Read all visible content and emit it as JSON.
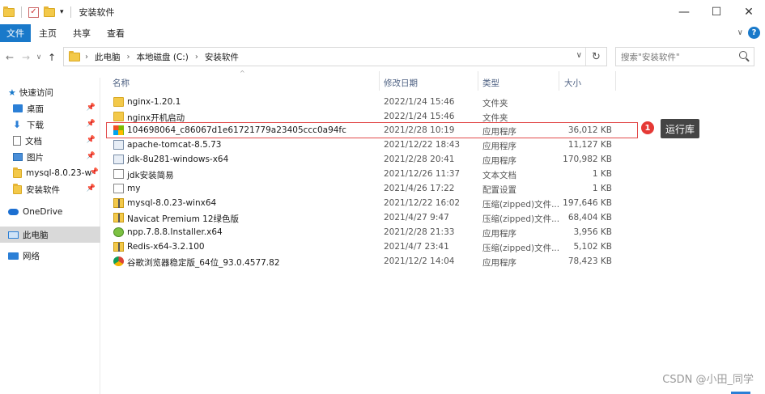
{
  "window": {
    "title": "安装软件",
    "controls": [
      "—",
      "☐",
      "✕"
    ]
  },
  "ribbon": {
    "tabs": [
      "文件",
      "主页",
      "共享",
      "查看"
    ],
    "active_tab": "文件"
  },
  "address": {
    "breadcrumbs": [
      "此电脑",
      "本地磁盘 (C:)",
      "安装软件"
    ],
    "search_placeholder": "搜索\"安装软件\""
  },
  "sidebar": {
    "items": [
      {
        "label": "快速访问",
        "icon": "star-icon"
      },
      {
        "label": "桌面",
        "icon": "desktop-icon",
        "pinned": true
      },
      {
        "label": "下载",
        "icon": "download-icon",
        "pinned": true
      },
      {
        "label": "文档",
        "icon": "document-icon",
        "pinned": true
      },
      {
        "label": "图片",
        "icon": "picture-icon",
        "pinned": true
      },
      {
        "label": "mysql-8.0.23-w",
        "icon": "folder-icon",
        "pinned": true
      },
      {
        "label": "安装软件",
        "icon": "folder-icon",
        "pinned": true
      },
      {
        "label": "OneDrive",
        "icon": "cloud-icon"
      },
      {
        "label": "此电脑",
        "icon": "computer-icon",
        "selected": true
      },
      {
        "label": "网络",
        "icon": "network-icon"
      }
    ]
  },
  "columns": {
    "name": "名称",
    "date": "修改日期",
    "type": "类型",
    "size": "大小"
  },
  "files": [
    {
      "name": "nginx-1.20.1",
      "date": "2022/1/24 15:46",
      "type": "文件夹",
      "size": "",
      "icon": "folder"
    },
    {
      "name": "nginx开机启动",
      "date": "2022/1/24 15:46",
      "type": "文件夹",
      "size": "",
      "icon": "folder"
    },
    {
      "name": "104698064_c86067d1e61721779a23405ccc0a94fc",
      "date": "2021/2/28 10:19",
      "type": "应用程序",
      "size": "36,012 KB",
      "icon": "win"
    },
    {
      "name": "apache-tomcat-8.5.73",
      "date": "2021/12/22 18:43",
      "type": "应用程序",
      "size": "11,127 KB",
      "icon": "app"
    },
    {
      "name": "jdk-8u281-windows-x64",
      "date": "2021/2/28 20:41",
      "type": "应用程序",
      "size": "170,982 KB",
      "icon": "app"
    },
    {
      "name": "jdk安装简易",
      "date": "2021/12/26 11:37",
      "type": "文本文档",
      "size": "1 KB",
      "icon": "doc"
    },
    {
      "name": "my",
      "date": "2021/4/26 17:22",
      "type": "配置设置",
      "size": "1 KB",
      "icon": "doc"
    },
    {
      "name": "mysql-8.0.23-winx64",
      "date": "2021/12/22 16:02",
      "type": "压缩(zipped)文件...",
      "size": "197,646 KB",
      "icon": "zip"
    },
    {
      "name": "Navicat Premium 12绿色版",
      "date": "2021/4/27 9:47",
      "type": "压缩(zipped)文件...",
      "size": "68,404 KB",
      "icon": "zip"
    },
    {
      "name": "npp.7.8.8.Installer.x64",
      "date": "2021/2/28 21:33",
      "type": "应用程序",
      "size": "3,956 KB",
      "icon": "npp"
    },
    {
      "name": "Redis-x64-3.2.100",
      "date": "2021/4/7 23:41",
      "type": "压缩(zipped)文件...",
      "size": "5,102 KB",
      "icon": "zip"
    },
    {
      "name": "谷歌浏览器稳定版_64位_93.0.4577.82",
      "date": "2021/12/2 14:04",
      "type": "应用程序",
      "size": "78,423 KB",
      "icon": "chrome"
    }
  ],
  "annotation": {
    "badge": "1",
    "label": "运行库"
  },
  "watermark": "CSDN @小田_同学"
}
